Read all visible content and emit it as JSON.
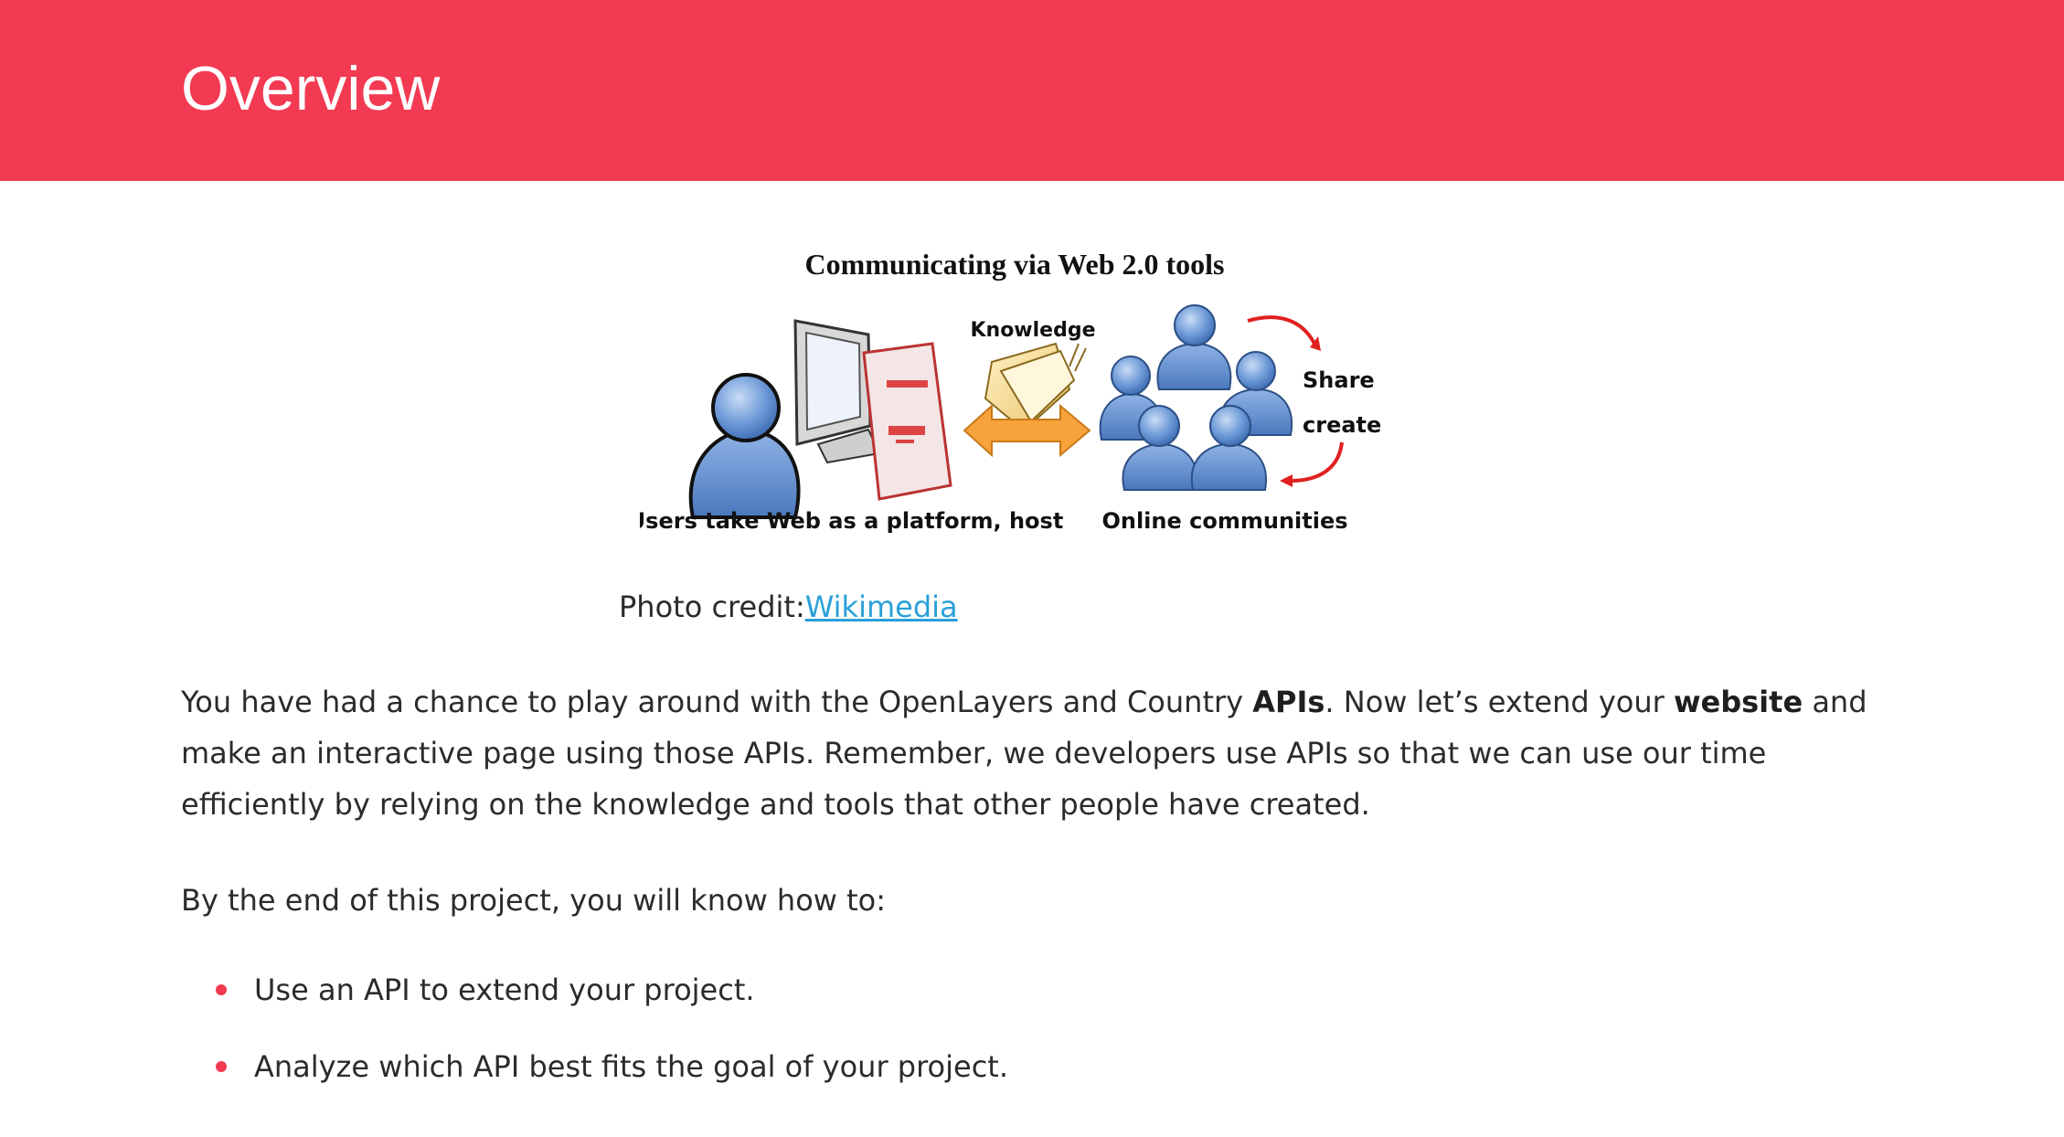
{
  "header": {
    "title": "Overview"
  },
  "figure": {
    "title": "Communicating via Web 2.0 tools",
    "labels": {
      "knowledge": "Knowledge",
      "share": "Share",
      "create": "create",
      "left_caption": "Users take Web as a platform, host",
      "right_caption": "Online communities"
    }
  },
  "caption": {
    "prefix": "Photo credit:",
    "link_text": "Wikimedia"
  },
  "intro": {
    "part1": "You have had a chance to play around with the OpenLayers and Country ",
    "bold1": "APIs",
    "part2": ". Now let’s extend your ",
    "bold2": "website",
    "part3": " and make an interactive page using those APIs. Remember, we developers use APIs so that we can use our time efficiently by relying on the knowledge and tools that other people have created."
  },
  "outcomes": {
    "lead": "By the end of this project, you will know how to:",
    "items": [
      "Use an API to extend your project.",
      "Analyze which API best fits the goal of your project."
    ]
  },
  "colors": {
    "accent": "#f23a52",
    "link": "#2aa0d8",
    "person_blue": "#6f9bd8"
  }
}
